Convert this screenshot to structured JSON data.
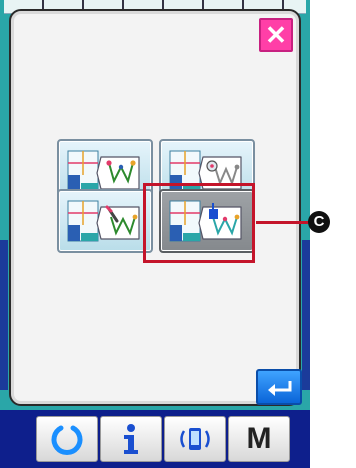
{
  "dialog": {
    "close_icon": "close-icon",
    "enter_icon": "enter-icon",
    "tiles": [
      {
        "name": "pattern-select-plain",
        "icon": "pattern-stitch-icon",
        "selected": false
      },
      {
        "name": "pattern-select-copy",
        "icon": "pattern-stitch-copy-icon",
        "selected": false
      },
      {
        "name": "pattern-select-edit",
        "icon": "pattern-stitch-edit-icon",
        "selected": false
      },
      {
        "name": "pattern-select-register",
        "icon": "pattern-stitch-register-icon",
        "selected": true
      }
    ]
  },
  "callout": {
    "label": "C"
  },
  "bottom_bar": {
    "buttons": [
      {
        "name": "ready-button",
        "icon": "ready-icon"
      },
      {
        "name": "info-button",
        "icon": "info-icon"
      },
      {
        "name": "communication-button",
        "icon": "communication-icon"
      },
      {
        "name": "mode-button",
        "label": "M"
      }
    ],
    "colors": {
      "bar": "#0e1f8c",
      "ready": "#1a8fff",
      "info": "#1a4fd0"
    }
  },
  "colors": {
    "close": "#ff3fa7",
    "highlight": "#c4142a",
    "enter": "#1a7ff0"
  }
}
